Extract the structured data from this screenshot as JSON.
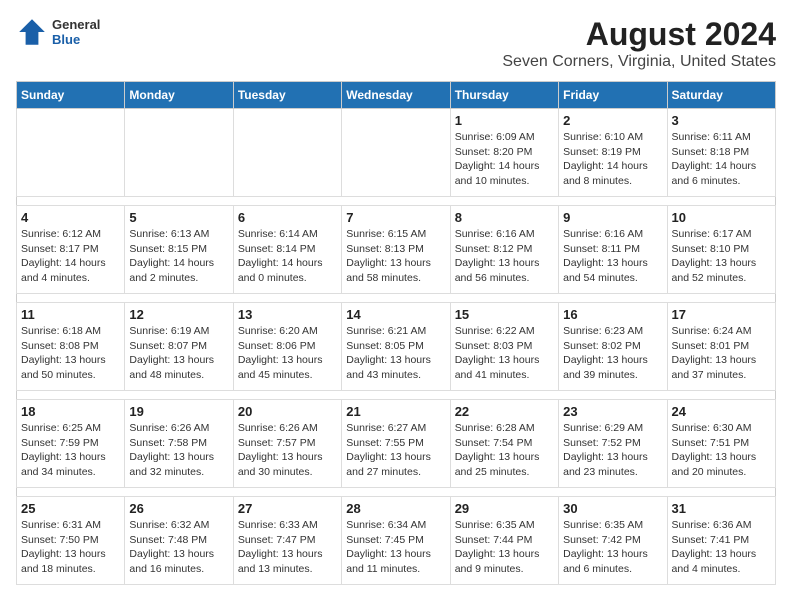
{
  "logo": {
    "general": "General",
    "blue": "Blue"
  },
  "header": {
    "title": "August 2024",
    "subtitle": "Seven Corners, Virginia, United States"
  },
  "weekdays": [
    "Sunday",
    "Monday",
    "Tuesday",
    "Wednesday",
    "Thursday",
    "Friday",
    "Saturday"
  ],
  "weeks": [
    [
      {
        "day": "",
        "info": ""
      },
      {
        "day": "",
        "info": ""
      },
      {
        "day": "",
        "info": ""
      },
      {
        "day": "",
        "info": ""
      },
      {
        "day": "1",
        "info": "Sunrise: 6:09 AM\nSunset: 8:20 PM\nDaylight: 14 hours\nand 10 minutes."
      },
      {
        "day": "2",
        "info": "Sunrise: 6:10 AM\nSunset: 8:19 PM\nDaylight: 14 hours\nand 8 minutes."
      },
      {
        "day": "3",
        "info": "Sunrise: 6:11 AM\nSunset: 8:18 PM\nDaylight: 14 hours\nand 6 minutes."
      }
    ],
    [
      {
        "day": "4",
        "info": "Sunrise: 6:12 AM\nSunset: 8:17 PM\nDaylight: 14 hours\nand 4 minutes."
      },
      {
        "day": "5",
        "info": "Sunrise: 6:13 AM\nSunset: 8:15 PM\nDaylight: 14 hours\nand 2 minutes."
      },
      {
        "day": "6",
        "info": "Sunrise: 6:14 AM\nSunset: 8:14 PM\nDaylight: 14 hours\nand 0 minutes."
      },
      {
        "day": "7",
        "info": "Sunrise: 6:15 AM\nSunset: 8:13 PM\nDaylight: 13 hours\nand 58 minutes."
      },
      {
        "day": "8",
        "info": "Sunrise: 6:16 AM\nSunset: 8:12 PM\nDaylight: 13 hours\nand 56 minutes."
      },
      {
        "day": "9",
        "info": "Sunrise: 6:16 AM\nSunset: 8:11 PM\nDaylight: 13 hours\nand 54 minutes."
      },
      {
        "day": "10",
        "info": "Sunrise: 6:17 AM\nSunset: 8:10 PM\nDaylight: 13 hours\nand 52 minutes."
      }
    ],
    [
      {
        "day": "11",
        "info": "Sunrise: 6:18 AM\nSunset: 8:08 PM\nDaylight: 13 hours\nand 50 minutes."
      },
      {
        "day": "12",
        "info": "Sunrise: 6:19 AM\nSunset: 8:07 PM\nDaylight: 13 hours\nand 48 minutes."
      },
      {
        "day": "13",
        "info": "Sunrise: 6:20 AM\nSunset: 8:06 PM\nDaylight: 13 hours\nand 45 minutes."
      },
      {
        "day": "14",
        "info": "Sunrise: 6:21 AM\nSunset: 8:05 PM\nDaylight: 13 hours\nand 43 minutes."
      },
      {
        "day": "15",
        "info": "Sunrise: 6:22 AM\nSunset: 8:03 PM\nDaylight: 13 hours\nand 41 minutes."
      },
      {
        "day": "16",
        "info": "Sunrise: 6:23 AM\nSunset: 8:02 PM\nDaylight: 13 hours\nand 39 minutes."
      },
      {
        "day": "17",
        "info": "Sunrise: 6:24 AM\nSunset: 8:01 PM\nDaylight: 13 hours\nand 37 minutes."
      }
    ],
    [
      {
        "day": "18",
        "info": "Sunrise: 6:25 AM\nSunset: 7:59 PM\nDaylight: 13 hours\nand 34 minutes."
      },
      {
        "day": "19",
        "info": "Sunrise: 6:26 AM\nSunset: 7:58 PM\nDaylight: 13 hours\nand 32 minutes."
      },
      {
        "day": "20",
        "info": "Sunrise: 6:26 AM\nSunset: 7:57 PM\nDaylight: 13 hours\nand 30 minutes."
      },
      {
        "day": "21",
        "info": "Sunrise: 6:27 AM\nSunset: 7:55 PM\nDaylight: 13 hours\nand 27 minutes."
      },
      {
        "day": "22",
        "info": "Sunrise: 6:28 AM\nSunset: 7:54 PM\nDaylight: 13 hours\nand 25 minutes."
      },
      {
        "day": "23",
        "info": "Sunrise: 6:29 AM\nSunset: 7:52 PM\nDaylight: 13 hours\nand 23 minutes."
      },
      {
        "day": "24",
        "info": "Sunrise: 6:30 AM\nSunset: 7:51 PM\nDaylight: 13 hours\nand 20 minutes."
      }
    ],
    [
      {
        "day": "25",
        "info": "Sunrise: 6:31 AM\nSunset: 7:50 PM\nDaylight: 13 hours\nand 18 minutes."
      },
      {
        "day": "26",
        "info": "Sunrise: 6:32 AM\nSunset: 7:48 PM\nDaylight: 13 hours\nand 16 minutes."
      },
      {
        "day": "27",
        "info": "Sunrise: 6:33 AM\nSunset: 7:47 PM\nDaylight: 13 hours\nand 13 minutes."
      },
      {
        "day": "28",
        "info": "Sunrise: 6:34 AM\nSunset: 7:45 PM\nDaylight: 13 hours\nand 11 minutes."
      },
      {
        "day": "29",
        "info": "Sunrise: 6:35 AM\nSunset: 7:44 PM\nDaylight: 13 hours\nand 9 minutes."
      },
      {
        "day": "30",
        "info": "Sunrise: 6:35 AM\nSunset: 7:42 PM\nDaylight: 13 hours\nand 6 minutes."
      },
      {
        "day": "31",
        "info": "Sunrise: 6:36 AM\nSunset: 7:41 PM\nDaylight: 13 hours\nand 4 minutes."
      }
    ]
  ]
}
